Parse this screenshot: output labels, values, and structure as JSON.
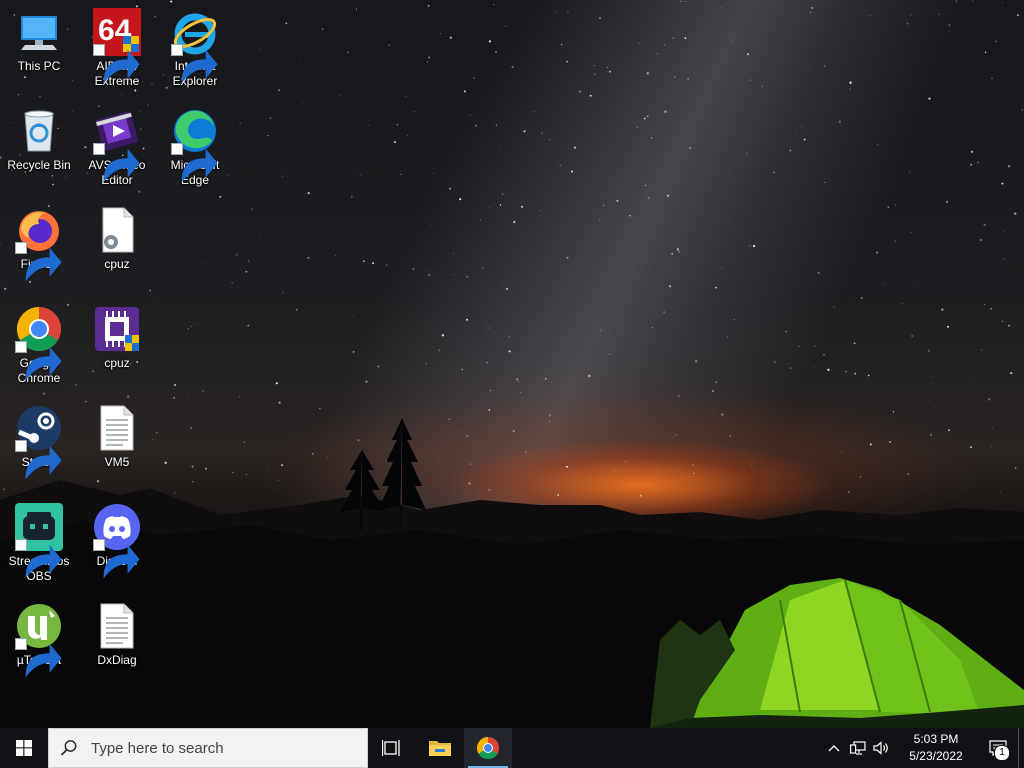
{
  "desktop": {
    "icons": [
      {
        "label": "This PC",
        "icon": "this-pc-icon",
        "shortcut": false
      },
      {
        "label": "AIDA64\nExtreme",
        "icon": "aida64-icon",
        "shortcut": true
      },
      {
        "label": "Internet\nExplorer",
        "icon": "internet-explorer-icon",
        "shortcut": true
      },
      {
        "label": "Recycle Bin",
        "icon": "recycle-bin-icon",
        "shortcut": false
      },
      {
        "label": "AVS Video\nEditor",
        "icon": "avs-video-editor-icon",
        "shortcut": true
      },
      {
        "label": "Microsoft\nEdge",
        "icon": "microsoft-edge-icon",
        "shortcut": true
      },
      {
        "label": "Firefox",
        "icon": "firefox-icon",
        "shortcut": true
      },
      {
        "label": "cpuz",
        "icon": "settings-file-icon",
        "shortcut": false
      },
      {
        "label": "Google\nChrome",
        "icon": "google-chrome-icon",
        "shortcut": true
      },
      {
        "label": "cpuz",
        "icon": "cpuz-icon",
        "shortcut": false
      },
      {
        "label": "Steam",
        "icon": "steam-icon",
        "shortcut": true
      },
      {
        "label": "VM5",
        "icon": "text-file-icon",
        "shortcut": false
      },
      {
        "label": "Streamlabs\nOBS",
        "icon": "streamlabs-obs-icon",
        "shortcut": true
      },
      {
        "label": "Discord",
        "icon": "discord-icon",
        "shortcut": true
      },
      {
        "label": "µTorrent",
        "icon": "utorrent-icon",
        "shortcut": true
      },
      {
        "label": "DxDiag",
        "icon": "text-file-icon",
        "shortcut": false
      }
    ]
  },
  "taskbar": {
    "start_icon": "windows-logo-icon",
    "search": {
      "placeholder": "Type here to search",
      "icon": "search-icon"
    },
    "buttons": [
      {
        "icon": "task-view-icon",
        "active": false
      },
      {
        "icon": "file-explorer-icon",
        "active": false
      },
      {
        "icon": "google-chrome-icon",
        "active": true
      }
    ],
    "tray": {
      "icons": [
        "chevron-up-icon",
        "network-icon",
        "volume-icon"
      ],
      "time": "5:03 PM",
      "date": "5/23/2022",
      "notification_count": "1"
    }
  }
}
